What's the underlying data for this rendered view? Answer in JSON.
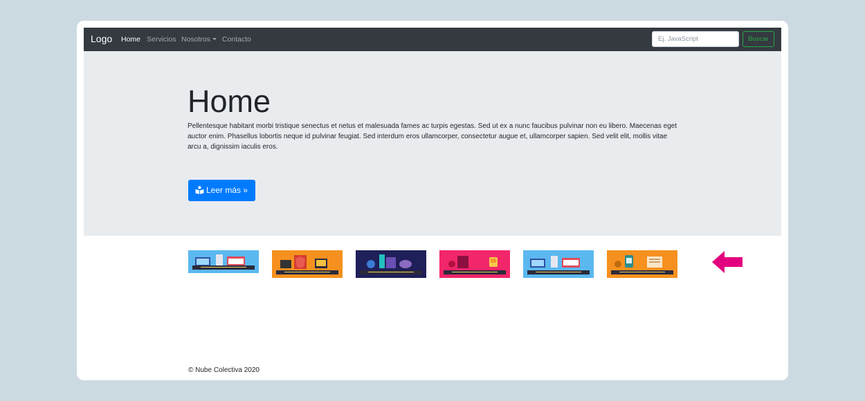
{
  "navbar": {
    "brand": "Logo",
    "items": [
      {
        "label": "Home",
        "active": true
      },
      {
        "label": "Servicios",
        "active": false
      },
      {
        "label": "Nosotros",
        "active": false,
        "dropdown": true
      },
      {
        "label": "Contacto",
        "active": false
      }
    ],
    "search_placeholder": "Ej. JavaScript",
    "search_value": "",
    "search_button": "Buscar"
  },
  "jumbotron": {
    "title": "Home",
    "text": "Pellentesque habitant morbi tristique senectus et netus et malesuada fames ac turpis egestas. Sed ut ex a nunc faucibus pulvinar non eu libero. Maecenas eget auctor enim. Phasellus lobortis neque id pulvinar feugiat. Sed interdum eros ullamcorper, consectetur augue et, ullamcorper sapien. Sed velit elit, mollis vitae arcu a, dignissim iaculis eros.",
    "button_label": "Leer más »",
    "button_icon": "book-reader-icon"
  },
  "thumbnails": [
    {
      "color": "#5bb8ef",
      "icon": "laptop-store-illustration"
    },
    {
      "color": "#f6911f",
      "icon": "angular-illustration"
    },
    {
      "color": "#1f1f5a",
      "icon": "tools-illustration"
    },
    {
      "color": "#f2266a",
      "icon": "javascript-illustration"
    },
    {
      "color": "#5bb8ef",
      "icon": "laptop-store-illustration"
    },
    {
      "color": "#f6911f",
      "icon": "jar-illustration"
    }
  ],
  "annotation": {
    "arrow_color": "#e3007f",
    "icon": "arrow-left-icon"
  },
  "footer": {
    "text": "© Nube Colectiva 2020"
  },
  "colors": {
    "page_bg": "#ccdae1",
    "navbar_bg": "#343a40",
    "jumbotron_bg": "#e9ecef",
    "primary": "#007bff",
    "success": "#28a745"
  }
}
